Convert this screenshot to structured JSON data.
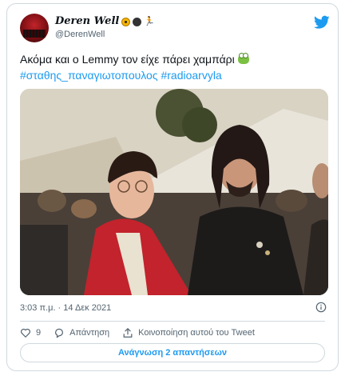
{
  "author": {
    "display_name": "Deren Well",
    "display_name_emojis": [
      "radioactive-emoji",
      "black-circle-emoji",
      "runner-emoji"
    ],
    "handle": "@DerenWell"
  },
  "tweet": {
    "text": "Ακόμα και ο Lemmy τον είχε πάρει χαμπάρι",
    "text_emoji": "frog-emoji",
    "hashtags": "#σταθης_παναγιωτοπουλος #radioarvyla",
    "timestamp": "3:03 π.μ. · 14 Δεκ 2021"
  },
  "actions": {
    "likes_count": "9",
    "reply_label": "Απάντηση",
    "share_label": "Κοινοποίηση αυτού του Tweet"
  },
  "replies_button": "Ανάγνωση 2 απαντήσεων",
  "colors": {
    "accent": "#1d9bf0",
    "text": "#0f1419",
    "muted": "#536471",
    "border": "#cfd9de"
  }
}
